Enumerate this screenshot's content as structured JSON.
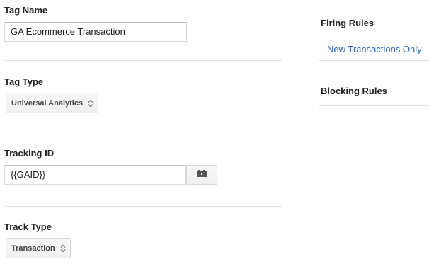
{
  "tag_name": {
    "label": "Tag Name",
    "value": "GA Ecommerce Transaction"
  },
  "tag_type": {
    "label": "Tag Type",
    "selected": "Universal Analytics"
  },
  "tracking_id": {
    "label": "Tracking ID",
    "value": "{{GAID}}",
    "variable_icon": "variable-picker-icon"
  },
  "track_type": {
    "label": "Track Type",
    "selected": "Transaction"
  },
  "firing_rules": {
    "title": "Firing Rules",
    "items": [
      "New Transactions Only"
    ]
  },
  "blocking_rules": {
    "title": "Blocking Rules",
    "items": []
  },
  "colors": {
    "link": "#2a63c4",
    "divider": "#e3e3e3",
    "text": "#222222"
  }
}
